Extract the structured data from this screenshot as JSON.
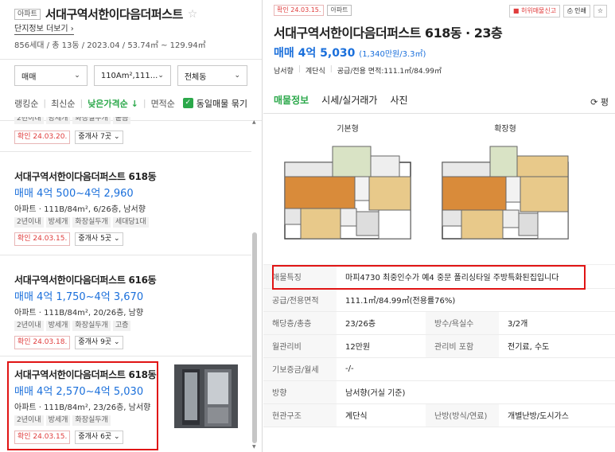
{
  "complex": {
    "badge": "아파트",
    "title": "서대구역서한이다음더퍼스트",
    "more_link": "단지정보 더보기",
    "info": "856세대 / 총 13동 / 2023.04 / 53.74㎡ ~ 129.94㎡"
  },
  "filters": {
    "deal": "매매",
    "area": "110Am²,111...",
    "dong": "전체동"
  },
  "sort": {
    "options": [
      "랭킹순",
      "최신순",
      "낮은가격순",
      "면적순"
    ],
    "active_index": 2,
    "same_listing": "동일매물 묶기"
  },
  "listings": [
    {
      "name": "",
      "price": "",
      "spec": "",
      "tags": [
        "2년이내",
        "방세개",
        "화장실두개",
        "붙음"
      ],
      "confirmed": "확인 24.03.20.",
      "agents": "중개사 7곳"
    },
    {
      "name": "서대구역서한이다음더퍼스트 618동",
      "price": "매매 4억 500~4억 2,960",
      "spec": "아파트 · 111B/84m², 6/26층, 남서향",
      "tags": [
        "2년이내",
        "방세개",
        "화장실두개",
        "세대당1대"
      ],
      "confirmed": "확인 24.03.15.",
      "agents": "중개사 5곳"
    },
    {
      "name": "서대구역서한이다음더퍼스트 616동",
      "price": "매매 4억 1,750~4억 3,670",
      "spec": "아파트 · 111B/84m², 20/26층, 남향",
      "tags": [
        "2년이내",
        "방세개",
        "화장실두개",
        "고층"
      ],
      "confirmed": "확인 24.03.18.",
      "agents": "중개사 9곳"
    },
    {
      "name": "서대구역서한이다음더퍼스트 618동",
      "price": "매매 4억 2,570~4억 5,030",
      "spec": "아파트 · 111B/84m², 23/26층, 남서향",
      "tags": [
        "2년이내",
        "방세개",
        "화장실두개"
      ],
      "confirmed": "확인 24.03.15.",
      "agents": "중개사 6곳"
    }
  ],
  "detail": {
    "confirmed": "확인 24.03.15.",
    "type": "아파트",
    "report": "허위매물신고",
    "print": "인쇄",
    "title": "서대구역서한이다음더퍼스트 618동 · 23층",
    "price": "매매 4억 5,030",
    "price_per": "(1,340만원/3.3㎡)",
    "spec": [
      "남서향",
      "계단식",
      "공급/전용 면적:111.1㎡/84.99㎡"
    ],
    "tabs": [
      "매물정보",
      "시세/실거래가",
      "사진"
    ],
    "refresh": "평",
    "floorplans": [
      "기본형",
      "확장형"
    ],
    "rows": [
      {
        "k": "매물특징",
        "v": "마피4730 최중인수가 예4 중문 폴리싱타일 주방특화된집입니다"
      },
      {
        "k": "공급/전용면적",
        "v": "111.1㎡/84.99㎡(전용률76%)"
      },
      {
        "k": "해당층/총층",
        "v": "23/26층",
        "k2": "방수/욕실수",
        "v2": "3/2개"
      },
      {
        "k": "월관리비",
        "v": "12만원",
        "k2": "관리비 포함",
        "v2": "전기료, 수도"
      },
      {
        "k": "기보증금/월세",
        "v": "-/-"
      },
      {
        "k": "방향",
        "v": "남서향(거실 기준)"
      },
      {
        "k": "현관구조",
        "v": "계단식",
        "k2": "난방(방식/연료)",
        "v2": "개별난방/도시가스"
      }
    ]
  },
  "colors": {
    "accent": "#2ba84a",
    "price": "#1a6fdb",
    "confirm": "#e03c3c",
    "highlight": "#e01414"
  }
}
